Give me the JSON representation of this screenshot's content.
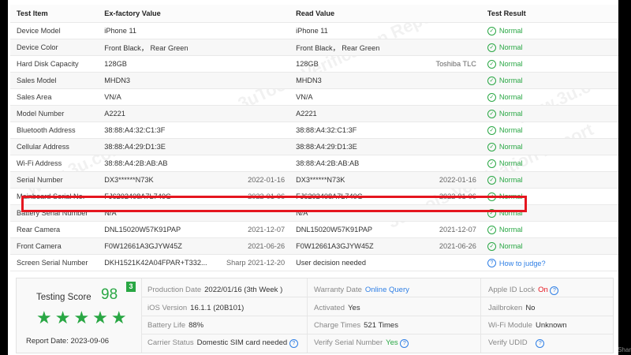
{
  "headers": [
    "Test Item",
    "Ex-factory Value",
    "Read Value",
    "Test Result"
  ],
  "rows": [
    {
      "item": "Device Model",
      "ex": "iPhone 11",
      "ex_sub": "",
      "read": "iPhone 11",
      "read_sub": "",
      "result": "Normal"
    },
    {
      "item": "Device Color",
      "ex": "Front Black， Rear Green",
      "ex_sub": "",
      "read": "Front Black， Rear Green",
      "read_sub": "",
      "result": "Normal"
    },
    {
      "item": "Hard Disk Capacity",
      "ex": "128GB",
      "ex_sub": "",
      "read": "128GB",
      "read_sub": "Toshiba TLC",
      "result": "Normal"
    },
    {
      "item": "Sales Model",
      "ex": "MHDN3",
      "ex_sub": "",
      "read": "MHDN3",
      "read_sub": "",
      "result": "Normal"
    },
    {
      "item": "Sales Area",
      "ex": "VN/A",
      "ex_sub": "",
      "read": "VN/A",
      "read_sub": "",
      "result": "Normal"
    },
    {
      "item": "Model Number",
      "ex": "A2221",
      "ex_sub": "",
      "read": "A2221",
      "read_sub": "",
      "result": "Normal"
    },
    {
      "item": "Bluetooth Address",
      "ex": "38:88:A4:32:C1:3F",
      "ex_sub": "",
      "read": "38:88:A4:32:C1:3F",
      "read_sub": "",
      "result": "Normal"
    },
    {
      "item": "Cellular Address",
      "ex": "38:88:A4:29:D1:3E",
      "ex_sub": "",
      "read": "38:88:A4:29:D1:3E",
      "read_sub": "",
      "result": "Normal"
    },
    {
      "item": "Wi-Fi Address",
      "ex": "38:88:A4:2B:AB:AB",
      "ex_sub": "",
      "read": "38:88:A4:2B:AB:AB",
      "read_sub": "",
      "result": "Normal"
    },
    {
      "item": "Serial Number",
      "ex": "DX3******N73K",
      "ex_sub": "2022-01-16",
      "read": "DX3******N73K",
      "read_sub": "2022-01-16",
      "result": "Normal"
    },
    {
      "item": "Mainboard Serial No.",
      "ex": "FJ6202408A7L740G",
      "ex_sub": "2022-01-06",
      "read": "FJ6202408A7L740G",
      "read_sub": "2022-01-06",
      "result": "Normal"
    },
    {
      "item": "Battery Serial Number",
      "ex": "N/A",
      "ex_sub": "",
      "read": "N/A",
      "read_sub": "",
      "result": "Normal"
    },
    {
      "item": "Rear Camera",
      "ex": "DNL15020W57K91PAP",
      "ex_sub": "2021-12-07",
      "read": "DNL15020W57K91PAP",
      "read_sub": "2021-12-07",
      "result": "Normal"
    },
    {
      "item": "Front Camera",
      "ex": "F0W12661A3GJYW45Z",
      "ex_sub": "2021-06-26",
      "read": "F0W12661A3GJYW45Z",
      "read_sub": "2021-06-26",
      "result": "Normal"
    },
    {
      "item": "Screen Serial Number",
      "ex": "DKH1521K42A04FPAR+T332...",
      "ex_sub": "Sharp 2021-12-20",
      "read": "User decision needed",
      "read_sub": "",
      "result": "How to judge?"
    }
  ],
  "summary": {
    "score_label": "Testing Score",
    "score": "98",
    "badge": "3",
    "stars": "★★★★★",
    "report_date": "Report Date:  2023-09-06",
    "production_label": "Production Date",
    "production_value": "2022/01/16 (3th Week )",
    "warranty_label": "Warranty Date",
    "warranty_value": "Online Query",
    "appleid_label": "Apple ID Lock",
    "appleid_value": "On",
    "ios_label": "iOS Version",
    "ios_value": "16.1.1 (20B101)",
    "activated_label": "Activated",
    "activated_value": "Yes",
    "jailbroken_label": "Jailbroken",
    "jailbroken_value": "No",
    "battery_label": "Battery Life",
    "battery_value": "88%",
    "charge_label": "Charge Times",
    "charge_value": "521 Times",
    "wifi_label": "Wi-Fi Module",
    "wifi_value": "Unknown",
    "carrier_label": "Carrier Status",
    "carrier_value": "Domestic SIM card needed",
    "verifysn_label": "Verify Serial Number",
    "verifysn_value": "Yes",
    "verifyudid_label": "Verify UDID"
  },
  "watermarks": [
    "3uTools Verification Report",
    "www.3u.com"
  ],
  "edge_text": "Shar",
  "colors": {
    "normal": "#29a744",
    "link": "#2f7fe5",
    "alert": "#e5161f"
  }
}
